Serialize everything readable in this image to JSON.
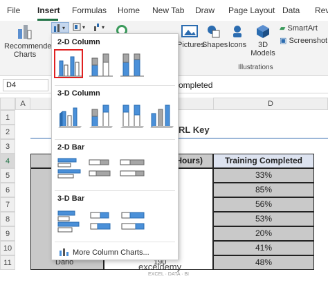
{
  "ribbon_tabs": [
    "File",
    "Insert",
    "Formulas",
    "Home",
    "New Tab",
    "Draw",
    "Page Layout",
    "Data",
    "Revi"
  ],
  "active_tab": "Insert",
  "ribbon": {
    "recommended_line1": "Recommended",
    "recommended_line2": "Charts",
    "pictures": "Pictures",
    "shapes": "Shapes",
    "icons": "Icons",
    "models_line1": "3D",
    "models_line2": "Models",
    "smartart": "SmartArt",
    "screenshot": "Screenshot",
    "illustrations_group": "Illustrations"
  },
  "formula_bar": {
    "cell_ref": "D4",
    "content": "ompleted"
  },
  "columns": [
    "A",
    "D"
  ],
  "rows": [
    "1",
    "2",
    "3",
    "4",
    "5",
    "6",
    "7",
    "8",
    "9",
    "10",
    "11"
  ],
  "sheet": {
    "title_fragment": "RL Key",
    "header_col_c": "Hours)",
    "header_col_d": "Training Completed",
    "values": [
      "33%",
      "85%",
      "56%",
      "53%",
      "20%",
      "41%",
      "48%"
    ],
    "row11_b": "Dario",
    "row11_c": "190"
  },
  "dropdown": {
    "sections": [
      "2-D Column",
      "3-D Column",
      "2-D Bar",
      "3-D Bar"
    ],
    "more": "More Column Charts..."
  },
  "watermark": {
    "name": "exceldemy",
    "sub": "EXCEL · DATA · BI"
  },
  "colors": {
    "accent": "#217346",
    "chart_blue": "#4a90d9",
    "chart_gray": "#a6a6a6",
    "highlight": "#e02020"
  }
}
